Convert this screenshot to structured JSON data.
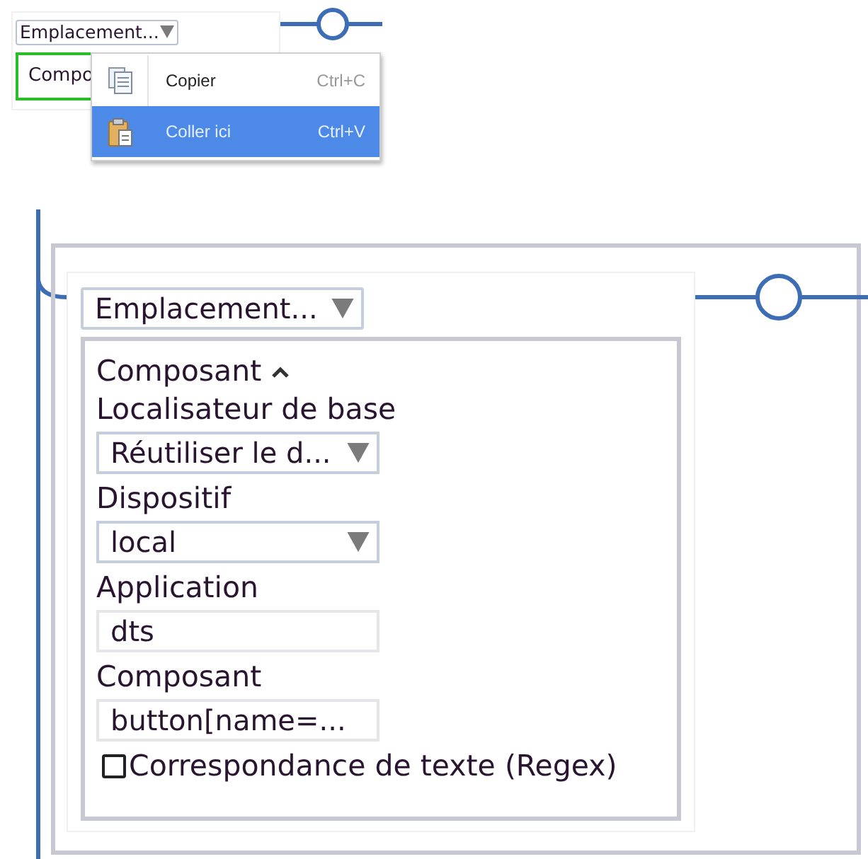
{
  "top_snippet": {
    "dropdown": {
      "value": "Emplacement..."
    },
    "field": {
      "value": "Compo",
      "focused": true
    }
  },
  "context_menu": {
    "items": [
      {
        "kind": "copy",
        "label": "Copier",
        "shortcut": "Ctrl+C",
        "selected": false
      },
      {
        "kind": "paste",
        "label": "Coller ici",
        "shortcut": "Ctrl+V",
        "selected": true
      }
    ]
  },
  "panel": {
    "dropdown": {
      "value": "Emplacement..."
    },
    "section": {
      "title": "Composant",
      "expanded": true
    },
    "fields": [
      {
        "kind": "select",
        "label": "Localisateur de base",
        "value": "Réutiliser le d..."
      },
      {
        "kind": "select",
        "label": "Dispositif",
        "value": "local"
      },
      {
        "kind": "text",
        "label": "Application",
        "value": "dts"
      },
      {
        "kind": "text",
        "label": "Composant",
        "value": "button[name=..."
      }
    ],
    "regex": {
      "label": "Correspondance de texte (Regex)",
      "checked": false
    }
  }
}
